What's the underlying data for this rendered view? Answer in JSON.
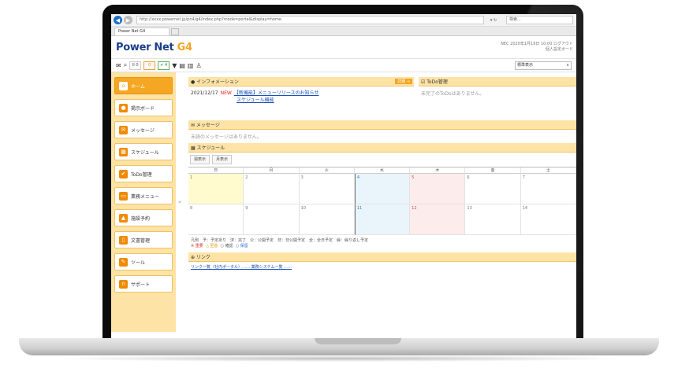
{
  "browser": {
    "url": "http://xxxx.powernet.jp/pn4/g4/index.php?mode=portal&display=home",
    "refresh": "▾ ↻",
    "search_placeholder": "検索...",
    "tab_title": "Power Net G4"
  },
  "app": {
    "logo_main": "Power Net ",
    "logo_suffix": "G4",
    "header_line1": "NEC 2020年1月19日 10:00 ログアウト",
    "header_line2": "個人設定ボード"
  },
  "toolbar": {
    "btn_a": "II 0",
    "btn_b": "0",
    "btn_c": "✔ 4",
    "select_value": "標準表示"
  },
  "sidebar": {
    "collapse": "«",
    "items": [
      {
        "label": "ホーム",
        "icon": "⌂"
      },
      {
        "label": "掲示ボード",
        "icon": "●"
      },
      {
        "label": "メッセージ",
        "icon": "✉"
      },
      {
        "label": "スケジュール",
        "icon": "▦"
      },
      {
        "label": "ToDo管理",
        "icon": "✔"
      },
      {
        "label": "業務メニュー",
        "icon": "▭"
      },
      {
        "label": "施設予約",
        "icon": "▲"
      },
      {
        "label": "文書管理",
        "icon": "▯"
      },
      {
        "label": "ツール",
        "icon": "✎"
      },
      {
        "label": "サポート",
        "icon": "∩"
      }
    ]
  },
  "info": {
    "title": "● インフォメーション",
    "more": "詳細 →",
    "date": "2021/12/17",
    "new": "NEW",
    "item1": "【新機能】メニューリリースのお知らせ",
    "item2": "スケジュール機能"
  },
  "todo": {
    "title": "☑ ToDo管理",
    "empty": "未完了のToDoはありません。"
  },
  "message": {
    "title": "✉ メッセージ",
    "empty": "未読のメッセージはありません。"
  },
  "schedule": {
    "title": "▦ スケジュール",
    "btn_1": "週表示",
    "btn_2": "月表示",
    "headers": [
      "日",
      "月",
      "火",
      "水",
      "木",
      "金",
      "土"
    ],
    "row1": [
      "1",
      "2",
      "3",
      "4",
      "5",
      "6",
      "7"
    ],
    "row2": [
      "8",
      "9",
      "10",
      "11",
      "12",
      "13",
      "14"
    ],
    "legend1": "凡例　予：予定あり　済：完了　公：公開予定　非：非公開予定　全：全日予定　繰：繰り返し予定",
    "legend2_a": "※ 重要",
    "legend2_b": "△ 至急",
    "legend2_c": "○ 確認",
    "legend2_d": "○ 保留"
  },
  "links": {
    "title": "⊕ リンク",
    "text": "リンク一覧（社内ポータル）…… 業務システム一覧 ……"
  }
}
